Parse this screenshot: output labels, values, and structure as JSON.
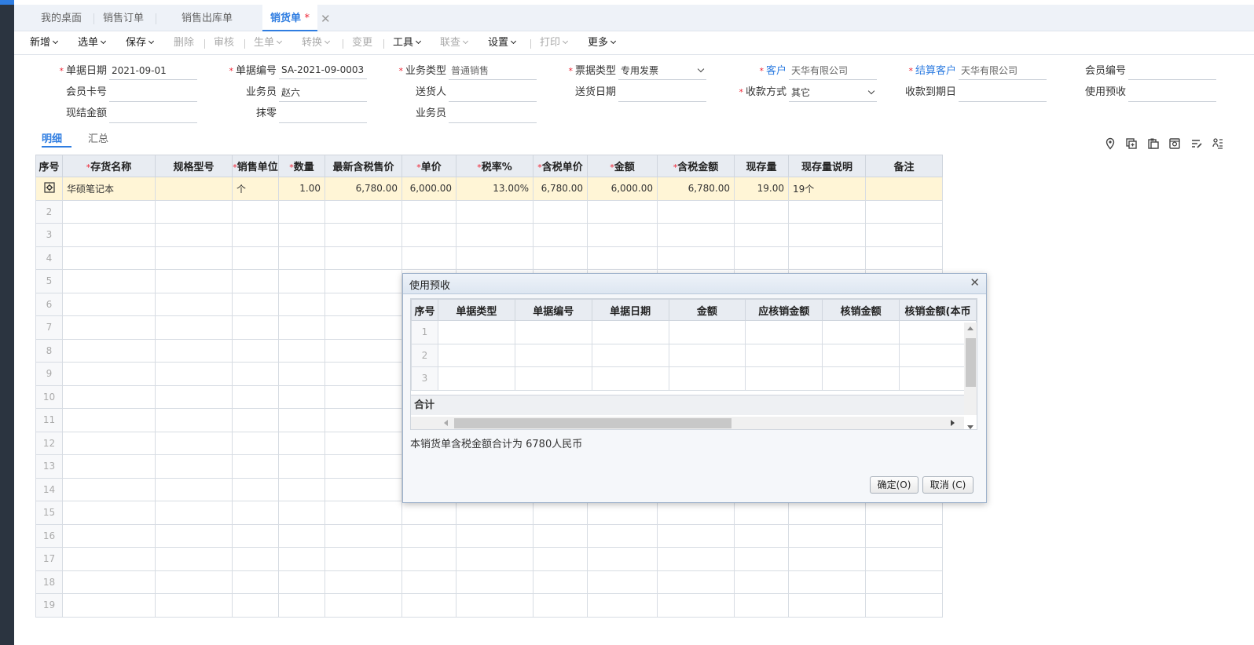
{
  "tabs": [
    {
      "label": "我的桌面"
    },
    {
      "label": "销售订单"
    },
    {
      "label": "销售出库单"
    },
    {
      "label": "销货单",
      "modified": "*"
    }
  ],
  "toolbar": {
    "new": "新增",
    "select": "选单",
    "save": "保存",
    "delete": "删除",
    "audit": "审核",
    "generate": "生单",
    "convert": "转换",
    "change": "变更",
    "tools": "工具",
    "query": "联查",
    "settings": "设置",
    "print": "打印",
    "more": "更多"
  },
  "form": {
    "doc_date": {
      "label": "单据日期",
      "value": "2021-09-01"
    },
    "doc_no": {
      "label": "单据编号",
      "value": "SA-2021-09-0003"
    },
    "biz_type": {
      "label": "业务类型",
      "value": "普通销售"
    },
    "invoice_type": {
      "label": "票据类型",
      "value": "专用发票"
    },
    "customer": {
      "label": "客户",
      "value": "天华有限公司"
    },
    "settle_customer": {
      "label": "结算客户",
      "value": "天华有限公司"
    },
    "member_no": {
      "label": "会员编号",
      "value": ""
    },
    "member_card": {
      "label": "会员卡号",
      "value": ""
    },
    "salesman": {
      "label": "业务员",
      "value": "赵六"
    },
    "deliverer": {
      "label": "送货人",
      "value": ""
    },
    "delivery_date": {
      "label": "送货日期",
      "value": ""
    },
    "payment_method": {
      "label": "收款方式",
      "value": "其它"
    },
    "due_date": {
      "label": "收款到期日",
      "value": ""
    },
    "use_prepay": {
      "label": "使用预收",
      "value": ""
    },
    "cash_amount": {
      "label": "现结金额",
      "value": ""
    },
    "rounding": {
      "label": "抹零",
      "value": ""
    },
    "salesman2": {
      "label": "业务员",
      "value": ""
    }
  },
  "subtabs": {
    "detail": "明细",
    "summary": "汇总"
  },
  "grid": {
    "headers": [
      "序号",
      "存货名称",
      "规格型号",
      "销售单位",
      "数量",
      "最新含税售价",
      "单价",
      "税率%",
      "含税单价",
      "金额",
      "含税金额",
      "现存量",
      "现存量说明",
      "备注"
    ],
    "row1": {
      "name": "华硕笔记本",
      "spec": "",
      "unit": "个",
      "qty": "1.00",
      "latest_price": "6,780.00",
      "price": "6,000.00",
      "tax_rate": "13.00%",
      "tax_price": "6,780.00",
      "amount": "6,000.00",
      "tax_amount": "6,780.00",
      "stock": "19.00",
      "stock_note": "19个",
      "remark": ""
    },
    "row_numbers": [
      "2",
      "3",
      "4",
      "5",
      "6",
      "7",
      "8",
      "9",
      "10",
      "11",
      "12",
      "13",
      "14",
      "15",
      "16",
      "17",
      "18",
      "19"
    ]
  },
  "dialog": {
    "title": "使用预收",
    "headers": [
      "序号",
      "单据类型",
      "单据编号",
      "单据日期",
      "金额",
      "应核销金额",
      "核销金额",
      "核销金额(本币"
    ],
    "rows": [
      "1",
      "2",
      "3"
    ],
    "total_label": "合计",
    "message": "本销货单含税金额合计为 6780人民币",
    "ok": "确定(O)",
    "cancel": "取消 (C)"
  },
  "colors": {
    "accent": "#2f7de1",
    "required": "#e22233",
    "highlight_row": "#fff5d6"
  },
  "icons": [
    "location-icon",
    "copy-add-icon",
    "paste-icon",
    "column-settings-icon",
    "edit-list-icon",
    "org-icon"
  ]
}
